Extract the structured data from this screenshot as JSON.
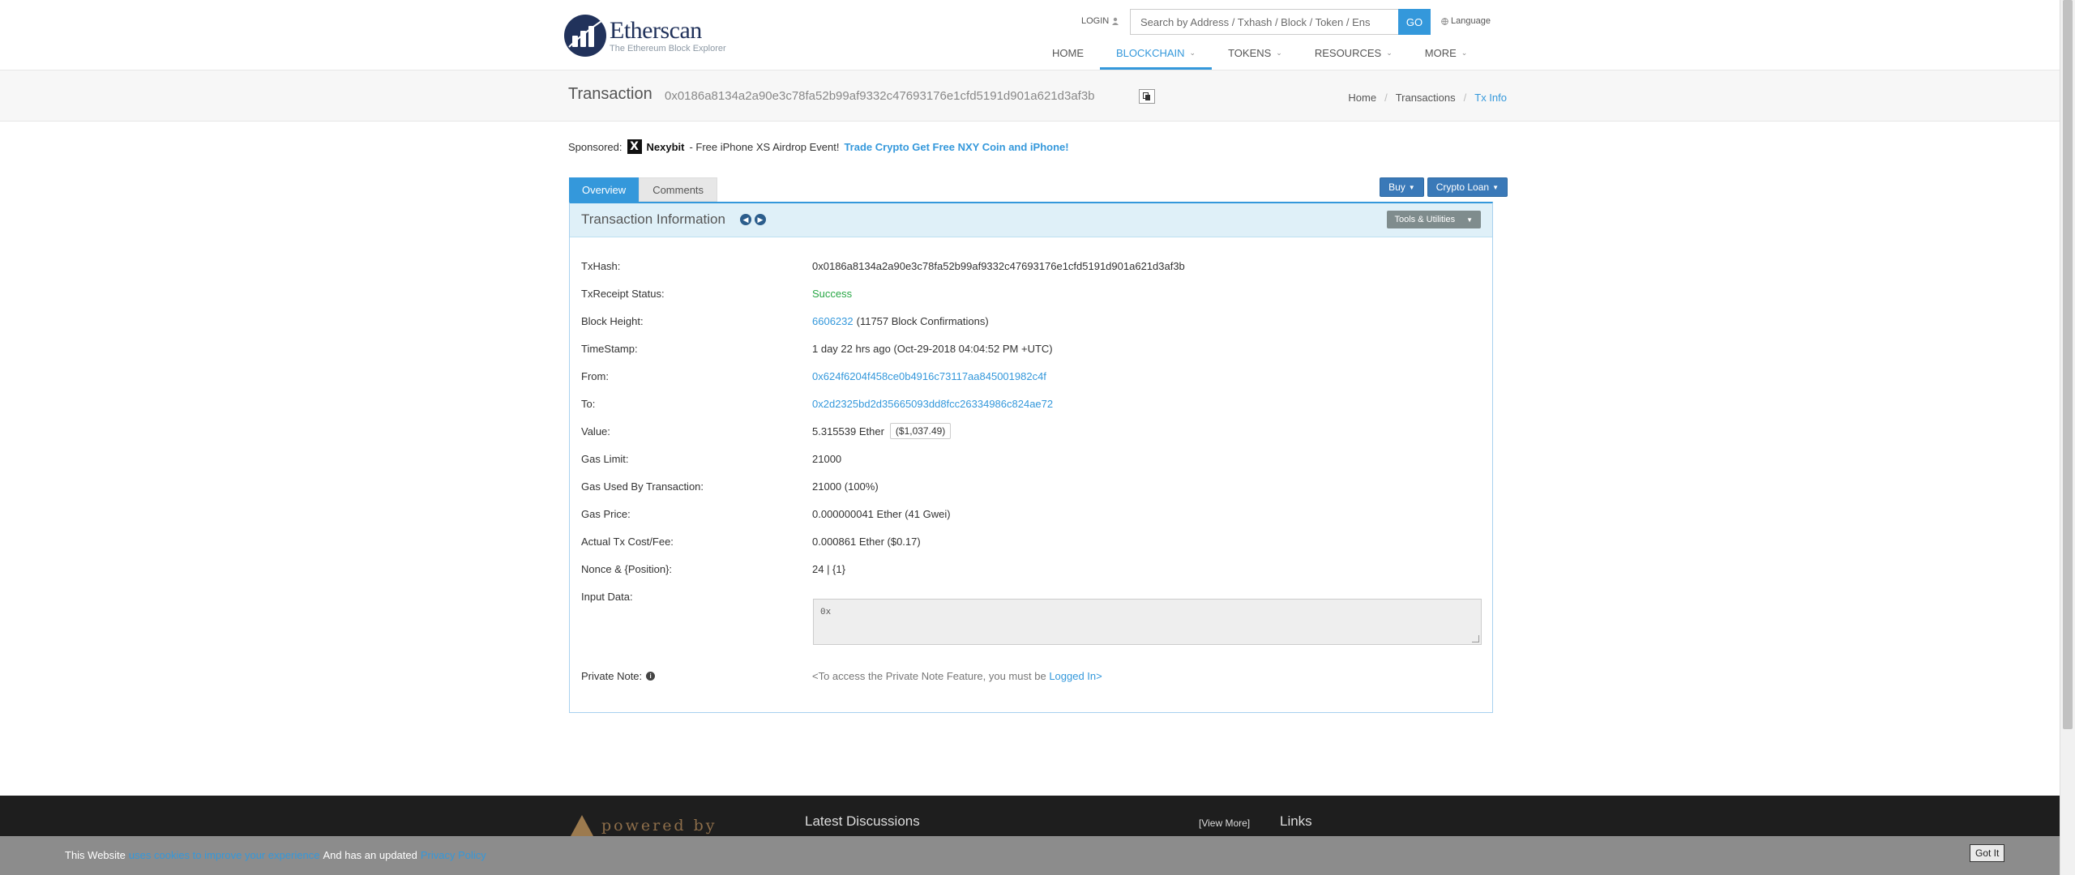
{
  "header": {
    "logo_name": "Etherscan",
    "logo_tagline": "The Ethereum Block Explorer",
    "login_label": "LOGIN",
    "search_placeholder": "Search by Address / Txhash / Block / Token / Ens",
    "go_label": "GO",
    "language_label": "Language",
    "nav": [
      {
        "label": "HOME",
        "caret": false,
        "active": false
      },
      {
        "label": "BLOCKCHAIN",
        "caret": true,
        "active": true
      },
      {
        "label": "TOKENS",
        "caret": true,
        "active": false
      },
      {
        "label": "RESOURCES",
        "caret": true,
        "active": false
      },
      {
        "label": "MORE",
        "caret": true,
        "active": false
      }
    ]
  },
  "subheader": {
    "title": "Transaction",
    "hash": "0x0186a8134a2a90e3c78fa52b99af9332c47693176e1cfd5191d901a621d3af3b",
    "breadcrumb": [
      "Home",
      "Transactions",
      "Tx Info"
    ]
  },
  "sponsored": {
    "label": "Sponsored:",
    "logo_letter": "X",
    "brand": "Nexybit",
    "text": "- Free iPhone XS Airdrop Event!",
    "cta": "Trade Crypto Get Free NXY Coin and iPhone!"
  },
  "tabs": [
    "Overview",
    "Comments"
  ],
  "buttons": {
    "buy": "Buy",
    "crypto_loan": "Crypto Loan",
    "tools": "Tools & Utilities"
  },
  "panel": {
    "title": "Transaction Information",
    "rows": [
      {
        "label": "TxHash:",
        "value": "0x0186a8134a2a90e3c78fa52b99af9332c47693176e1cfd5191d901a621d3af3b"
      },
      {
        "label": "TxReceipt Status:",
        "value": "Success"
      },
      {
        "label": "Block Height:",
        "link": "6606232",
        "value": "(11757 Block Confirmations)"
      },
      {
        "label": "TimeStamp:",
        "value": "1 day 22 hrs ago (Oct-29-2018 04:04:52 PM +UTC)"
      },
      {
        "label": "From:",
        "link": "0x624f6204f458ce0b4916c73117aa845001982c4f"
      },
      {
        "label": "To:",
        "link": "0x2d2325bd2d35665093dd8fcc26334986c824ae72"
      },
      {
        "label": "Value:",
        "value": "5.315539 Ether",
        "price": "($1,037.49)"
      },
      {
        "label": "Gas Limit:",
        "value": "21000"
      },
      {
        "label": "Gas Used By Transaction:",
        "value": "21000 (100%)"
      },
      {
        "label": "Gas Price:",
        "value": "0.000000041 Ether (41 Gwei)"
      },
      {
        "label": "Actual Tx Cost/Fee:",
        "value": "0.000861 Ether ($0.17)"
      },
      {
        "label": "Nonce & {Position}:",
        "value": "24 | {1}"
      }
    ],
    "input_label": "Input Data:",
    "input_value": "0x",
    "private_label": "Private Note:",
    "private_text": "<To access the Private Note Feature, you must be",
    "private_link": "Logged In>"
  },
  "footer": {
    "powered_by": "powered by",
    "latest_discussions": "Latest Discussions",
    "view_more": "[View More]",
    "links": "Links"
  },
  "cookie": {
    "text1": "This Website",
    "link1": "uses cookies to improve your experience",
    "text2": "And has an updated",
    "link2": "Privacy Policy",
    "button": "Got It"
  },
  "colors": {
    "accent": "#3498db",
    "success": "#28a745",
    "brand_navy": "#21325b"
  }
}
